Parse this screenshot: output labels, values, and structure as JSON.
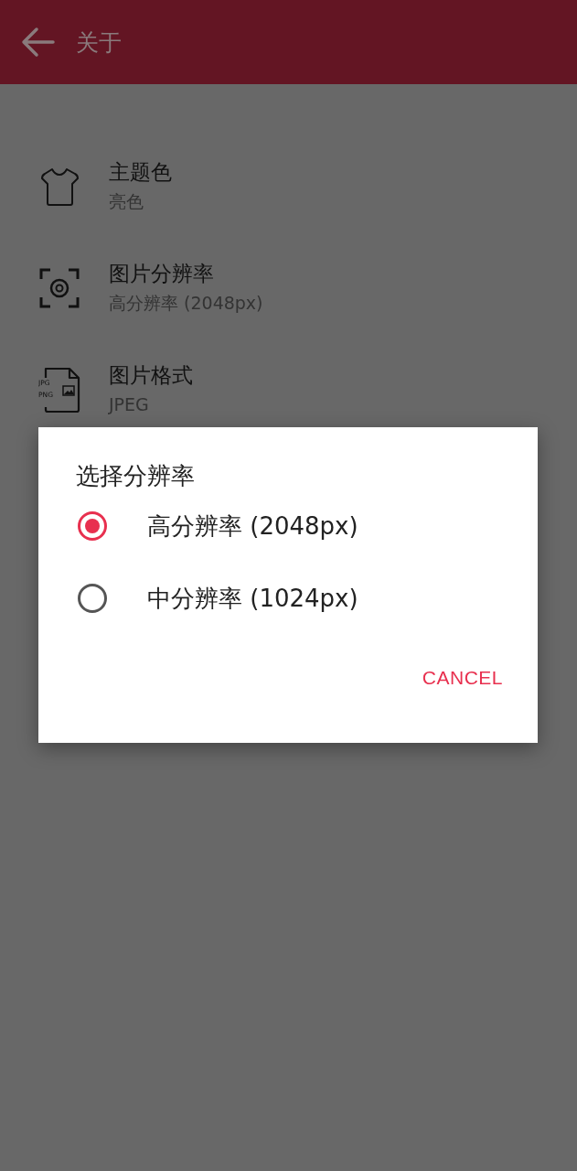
{
  "toolbar": {
    "title": "关于"
  },
  "settings": [
    {
      "kind": "theme",
      "title": "主题色",
      "value": "亮色"
    },
    {
      "kind": "resolution",
      "title": "图片分辨率",
      "value": "高分辨率 (2048px)"
    },
    {
      "kind": "format",
      "title": "图片格式",
      "value": "JPEG",
      "icon_text": [
        "JPG",
        "PNG"
      ]
    }
  ],
  "dialog": {
    "title": "选择分辨率",
    "options": [
      {
        "label": "高分辨率 (2048px)",
        "selected": true
      },
      {
        "label": "中分辨率 (1024px)",
        "selected": false
      }
    ],
    "button": "CANCEL"
  }
}
